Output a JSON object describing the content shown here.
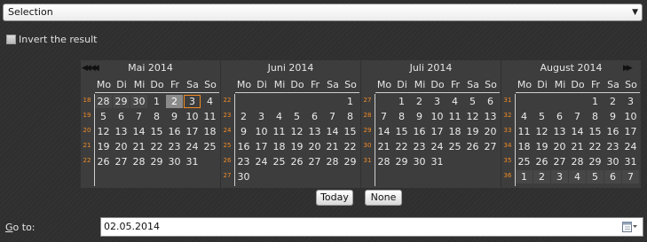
{
  "selection": {
    "value": "Selection",
    "arrow_icon": "dropdown-arrow-icon"
  },
  "invert": {
    "label": "Invert the result",
    "checked": false
  },
  "weekday_headers": [
    "Mo",
    "Di",
    "Mi",
    "Do",
    "Fr",
    "Sa",
    "So"
  ],
  "calendars": [
    {
      "title": "Mai 2014",
      "weeks": [
        "18",
        "19",
        "20",
        "21",
        "22"
      ],
      "days": [
        28,
        29,
        30,
        1,
        2,
        3,
        4,
        5,
        6,
        7,
        8,
        9,
        10,
        11,
        12,
        13,
        14,
        15,
        16,
        17,
        18,
        19,
        20,
        21,
        22,
        23,
        24,
        25,
        26,
        27,
        28,
        29,
        30,
        31
      ]
    },
    {
      "title": "Juni 2014",
      "weeks": [
        "22",
        "23",
        "24",
        "25",
        "26",
        "27"
      ],
      "days": [
        1,
        2,
        3,
        4,
        5,
        6,
        7,
        8,
        9,
        10,
        11,
        12,
        13,
        14,
        15,
        16,
        17,
        18,
        19,
        20,
        21,
        22,
        23,
        24,
        25,
        26,
        27,
        28,
        29,
        30
      ]
    },
    {
      "title": "Juli 2014",
      "weeks": [
        "27",
        "28",
        "29",
        "30",
        "31"
      ],
      "days": [
        1,
        2,
        3,
        4,
        5,
        6,
        7,
        8,
        9,
        10,
        11,
        12,
        13,
        14,
        15,
        16,
        17,
        18,
        19,
        20,
        21,
        22,
        23,
        24,
        25,
        26,
        27,
        28,
        29,
        30,
        31
      ]
    },
    {
      "title": "August 2014",
      "weeks": [
        "31",
        "32",
        "33",
        "34",
        "35",
        "36"
      ],
      "days": [
        1,
        2,
        3,
        4,
        5,
        6,
        7,
        8,
        9,
        10,
        11,
        12,
        13,
        14,
        15,
        16,
        17,
        18,
        19,
        20,
        21,
        22,
        23,
        24,
        25,
        26,
        27,
        28,
        29,
        30,
        31,
        1,
        2,
        3,
        4,
        5,
        6,
        7
      ]
    }
  ],
  "buttons": {
    "today": "Today",
    "none": "None"
  },
  "goto": {
    "label": "Go to:",
    "value": "02.05.2014",
    "icon": "calendar-icon"
  },
  "colors": {
    "week_number": "#f08a24",
    "today_outline": "#f08a24",
    "selected_day": "#8a8a8a"
  }
}
